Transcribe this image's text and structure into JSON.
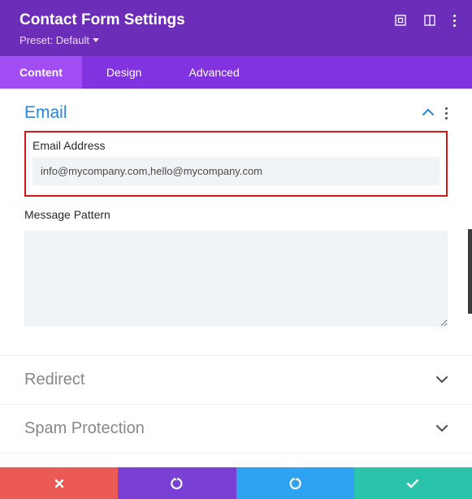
{
  "header": {
    "title": "Contact Form Settings",
    "preset_label": "Preset: Default"
  },
  "tabs": {
    "content": "Content",
    "design": "Design",
    "advanced": "Advanced"
  },
  "sections": {
    "email": {
      "title": "Email",
      "email_label": "Email Address",
      "email_value": "info@mycompany.com,hello@mycompany.com",
      "message_label": "Message Pattern",
      "message_value": ""
    },
    "redirect": {
      "title": "Redirect"
    },
    "spam": {
      "title": "Spam Protection"
    }
  }
}
